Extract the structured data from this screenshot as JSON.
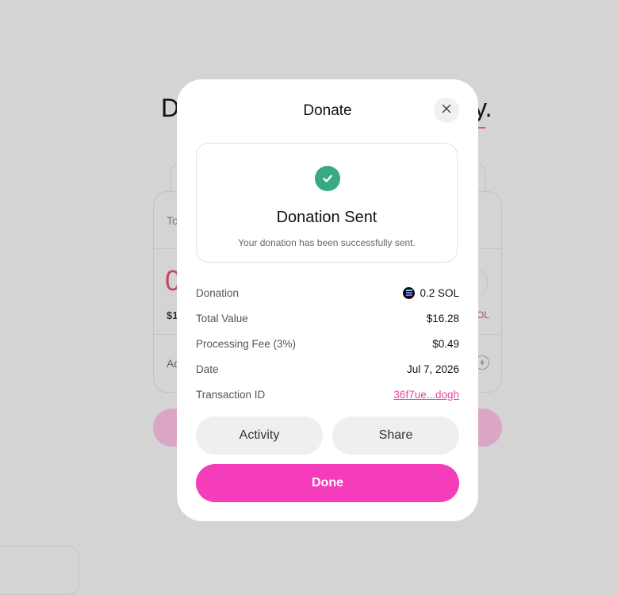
{
  "background": {
    "title_start": "D",
    "title_end": "y.",
    "to_label": "To",
    "amount": "0",
    "usd_value": "$1",
    "sol_suffix": "OL",
    "address_label": "Ad",
    "plus_glyph": "+"
  },
  "modal": {
    "title": "Donate",
    "close_icon": "close-icon",
    "success": {
      "icon": "check-circle-icon",
      "title": "Donation Sent",
      "subtitle": "Your donation has been successfully sent."
    },
    "details": {
      "donation_label": "Donation",
      "donation_value": "0.2 SOL",
      "donation_icon": "solana-icon",
      "total_value_label": "Total Value",
      "total_value": "$16.28",
      "fee_label": "Processing Fee (3%)",
      "fee_value": "$0.49",
      "date_label": "Date",
      "date_value": "Jul 7, 2026",
      "tx_label": "Transaction ID",
      "tx_value": "36f7ue...dogh"
    },
    "buttons": {
      "activity": "Activity",
      "share": "Share",
      "done": "Done"
    }
  },
  "colors": {
    "accent": "#f53dbb",
    "success": "#3aa885",
    "link": "#e8479f",
    "overlay": "#d4d4d4"
  }
}
